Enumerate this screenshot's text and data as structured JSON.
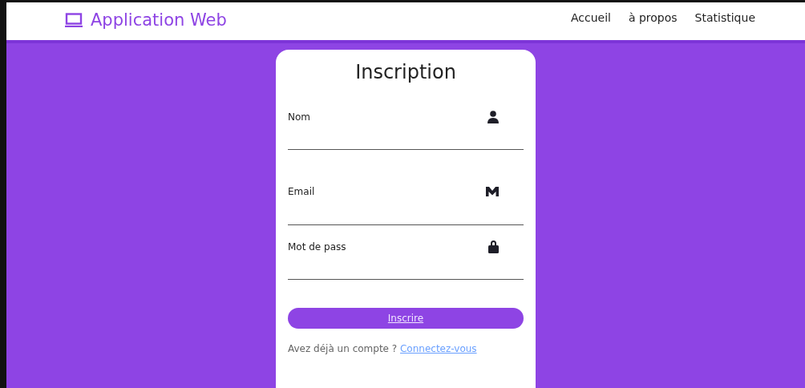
{
  "navbar": {
    "brand": "Application Web",
    "links": [
      "Accueil",
      "à propos",
      "Statistique"
    ]
  },
  "form": {
    "title": "Inscription",
    "fields": [
      {
        "label": "Nom",
        "kind": "person"
      },
      {
        "label": "Email",
        "kind": "mail"
      },
      {
        "label": "Mot de pass",
        "kind": "lock"
      }
    ],
    "submit": "Inscrire",
    "footer_text": "Avez déjà un compte ?",
    "footer_link": "Connectez-vous"
  }
}
